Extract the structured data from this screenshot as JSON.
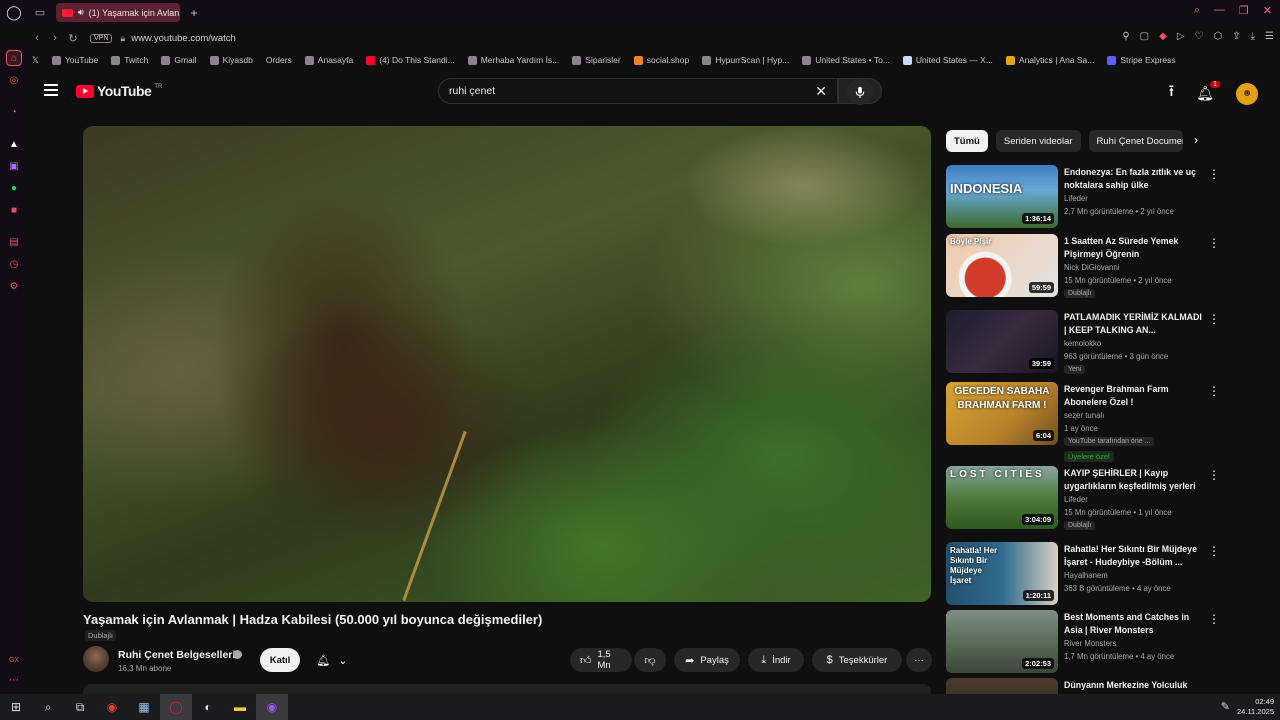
{
  "browser": {
    "tab_title": "(1) Yaşamak için Avlan",
    "url": "www.youtube.com/watch",
    "vpn_label": "VPN",
    "bookmarks": [
      "YouTube",
      "Twitch",
      "Gmail",
      "Kiyasdb",
      "Orders",
      "Anasayfa",
      "(4) Do This Standi...",
      "Merhaba Yardım İs...",
      "Siparisler",
      "social.shop",
      "HypurrScan | Hyp...",
      "United States • To...",
      "United States — X...",
      "Analytics | Ana Sa...",
      "Stripe Express"
    ]
  },
  "youtube": {
    "logo_text": "YouTube",
    "country_code": "TR",
    "search_value": "ruhi çenet",
    "notification_count": "1"
  },
  "video": {
    "title": "Yaşamak için Avlanmak | Hadza Kabilesi (50.000 yıl boyunca değişmediler)",
    "dub_badge": "Dublajlı",
    "channel_name": "Ruhi Çenet Belgeselleri",
    "subscribers": "16,3 Mn abone",
    "join_label": "Katıl",
    "likes": "1,5 Mn",
    "share_label": "Paylaş",
    "download_label": "İndir",
    "thanks_label": "Teşekkürler",
    "more_label": "···"
  },
  "chips": [
    "Tümü",
    "Seriden videolar",
    "Ruhi Çenet Documen"
  ],
  "recommendations": [
    {
      "title": "Endonezya: En fazla zıtlık ve uç noktalara sahip ülke",
      "channel": "Lifeder",
      "meta": "2,7 Mn görüntüleme • 2 yıl önce",
      "duration": "1:36:14",
      "thumb_text": "INDONESIA",
      "badge": "",
      "badge2": ""
    },
    {
      "title": "1 Saatten Az Sürede Yemek Pişirmeyi Öğrenin",
      "channel": "Nick DiGiovanni",
      "meta": "15 Mn görüntüleme • 2 yıl önce",
      "duration": "59:59",
      "thumb_text": "Böyle Pişir",
      "badge": "Dublajlı",
      "badge2": ""
    },
    {
      "title": "PATLAMADIK YERİMİZ KALMADI | KEEP TALKING AN...",
      "channel": "kemolokko",
      "meta": "963 görüntüleme • 3 gün önce",
      "duration": "39:59",
      "thumb_text": "",
      "badge": "Yeni",
      "badge2": ""
    },
    {
      "title": "Revenger Brahman Farm Abonelere Özel !",
      "channel": "sezer tunalı",
      "meta": "1 ay önce",
      "duration": "6:04",
      "thumb_text": "GECEDEN SABAHA BRAHMAN FARM !",
      "badge": "YouTube tarafından öne ...",
      "badge2": "Üyelere özel"
    },
    {
      "title": "KAYIP ŞEHİRLER | Kayıp uygarlıkların keşfedilmiş yerleri",
      "channel": "Lifeder",
      "meta": "15 Mn görüntüleme • 1 yıl önce",
      "duration": "3:04:09",
      "thumb_text": "LOST CITIES",
      "badge": "Dublajlı",
      "badge2": ""
    },
    {
      "title": "Rahatla! Her Sıkıntı Bir Müjdeye İşaret - Hudeybiye -Bölüm ...",
      "channel": "Hayalhanem",
      "meta": "363 B görüntüleme • 4 ay önce",
      "duration": "1:20:11",
      "thumb_text": "Rahatla! Her Sıkıntı Bir Müjdeye İşaret",
      "badge": "",
      "badge2": ""
    },
    {
      "title": "Best Moments and Catches in Asia | River Monsters",
      "channel": "River Monsters",
      "meta": "1,7 Mn görüntüleme • 4 ay önce",
      "duration": "2:02:53",
      "thumb_text": "",
      "badge": "",
      "badge2": ""
    },
    {
      "title": "Dünyanın Merkezine Yolculuk",
      "channel": "",
      "meta": "",
      "duration": "",
      "thumb_text": "",
      "badge": "",
      "badge2": ""
    }
  ],
  "taskbar": {
    "time": "02:49",
    "date": "24.11.2025"
  },
  "colors": {
    "yt_red": "#ff0033",
    "bg": "#0f0f0f",
    "opera_accent": "#e0556f"
  }
}
